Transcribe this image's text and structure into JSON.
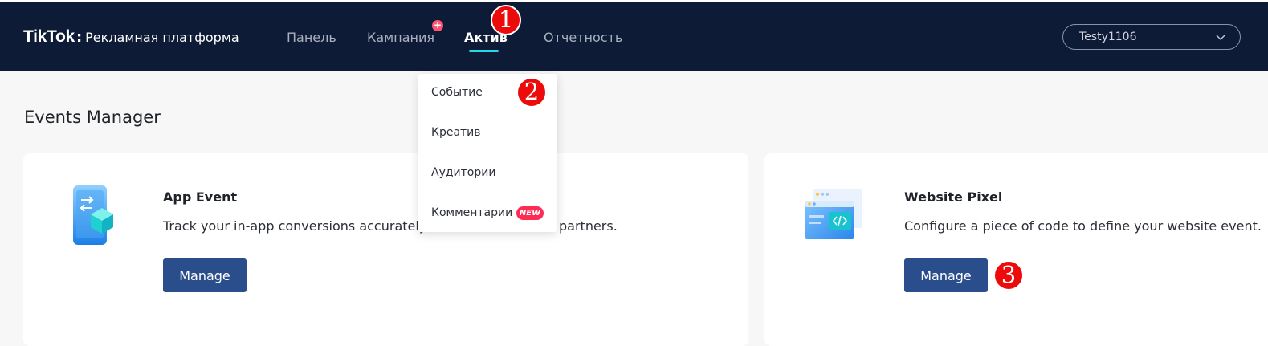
{
  "header": {
    "logo_brand": "TikTok",
    "logo_colon": ":",
    "logo_subtitle": "Рекламная платформа",
    "nav": [
      {
        "label": "Панель"
      },
      {
        "label": "Кампания"
      },
      {
        "label": "Актив",
        "active": true
      },
      {
        "label": "Отчетность"
      }
    ],
    "campaign_badge": "+",
    "account": {
      "name": "Testy1106"
    }
  },
  "dropdown": {
    "items": [
      {
        "label": "Событие"
      },
      {
        "label": "Креатив"
      },
      {
        "label": "Аудитории"
      },
      {
        "label": "Комментарии",
        "badge": "NEW"
      }
    ]
  },
  "markers": [
    "1",
    "2",
    "3"
  ],
  "page": {
    "title": "Events Manager"
  },
  "cards": [
    {
      "title": "App Event",
      "desc_left": "Track your in-app conversions accurately w",
      "desc_right": "partners.",
      "button": "Manage",
      "icon": "app-phone-cube-icon"
    },
    {
      "title": "Website Pixel",
      "desc": "Configure a piece of code to define your website event.",
      "button": "Manage",
      "icon": "website-code-window-icon"
    }
  ],
  "colors": {
    "header_bg": "#0e1b36",
    "active_underline": "#26d6e6",
    "button_bg": "#2a4e8c",
    "badge_red": "#fe2c55",
    "marker_red": "#ec0a0a"
  }
}
